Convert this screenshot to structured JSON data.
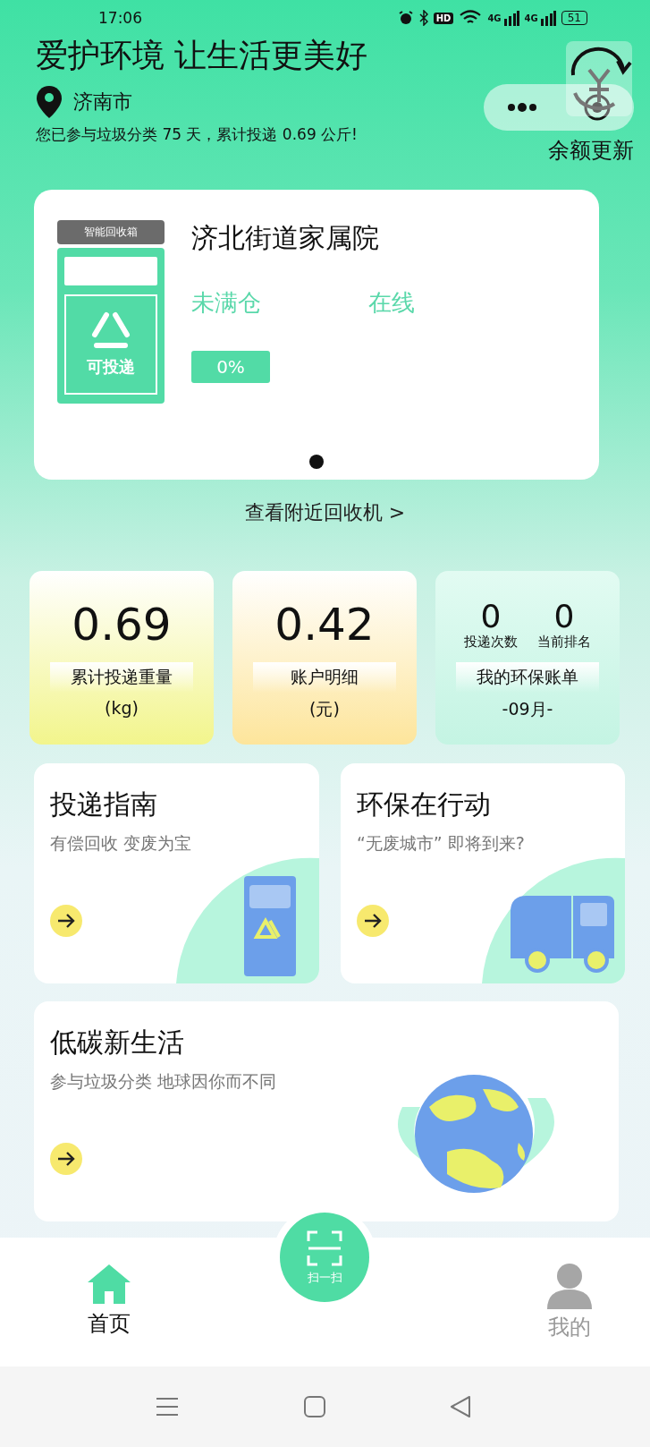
{
  "status_bar": {
    "time": "17:06",
    "hd": "HD",
    "networks": [
      "4G",
      "4G"
    ],
    "battery": "51"
  },
  "header": {
    "title": "爱护环境 让生活更美好",
    "location": "济南市",
    "summary": "您已参与垃圾分类 75 天，累计投递 0.69 公斤!",
    "balance_refresh": "余额更新"
  },
  "machine_card": {
    "badge": "智能回收箱",
    "bin_label": "可投递",
    "name": "济北街道家属院",
    "capacity_status": "未满仓",
    "online_status": "在线",
    "fill_percent": "0%",
    "dots": [
      {
        "selected": true
      }
    ]
  },
  "nearby_link": "查看附近回收机 >",
  "stats": [
    {
      "kind": "single",
      "value": "0.69",
      "label": "累计投递重量",
      "unit": "(kg)"
    },
    {
      "kind": "single",
      "value": "0.42",
      "label": "账户明细",
      "unit": "(元)"
    },
    {
      "kind": "pair",
      "pairs": [
        {
          "value": "0",
          "label": "投递次数"
        },
        {
          "value": "0",
          "label": "当前排名"
        }
      ],
      "label": "我的环保账单",
      "unit": "-09月-"
    }
  ],
  "tiles": [
    {
      "kind": "bin",
      "title": "投递指南",
      "subtitle": "有偿回收 变废为宝"
    },
    {
      "kind": "truck",
      "title": "环保在行动",
      "subtitle": "“无废城市” 即将到来?"
    }
  ],
  "feature": {
    "kind": "globe",
    "title": "低碳新生活",
    "subtitle": "参与垃圾分类 地球因你而不同"
  },
  "scan_button": {
    "label": "扫一扫"
  },
  "tab_bar": [
    {
      "kind": "home",
      "label": "首页",
      "selected": true
    },
    {
      "kind": "profile",
      "label": "我的",
      "selected": false
    }
  ]
}
